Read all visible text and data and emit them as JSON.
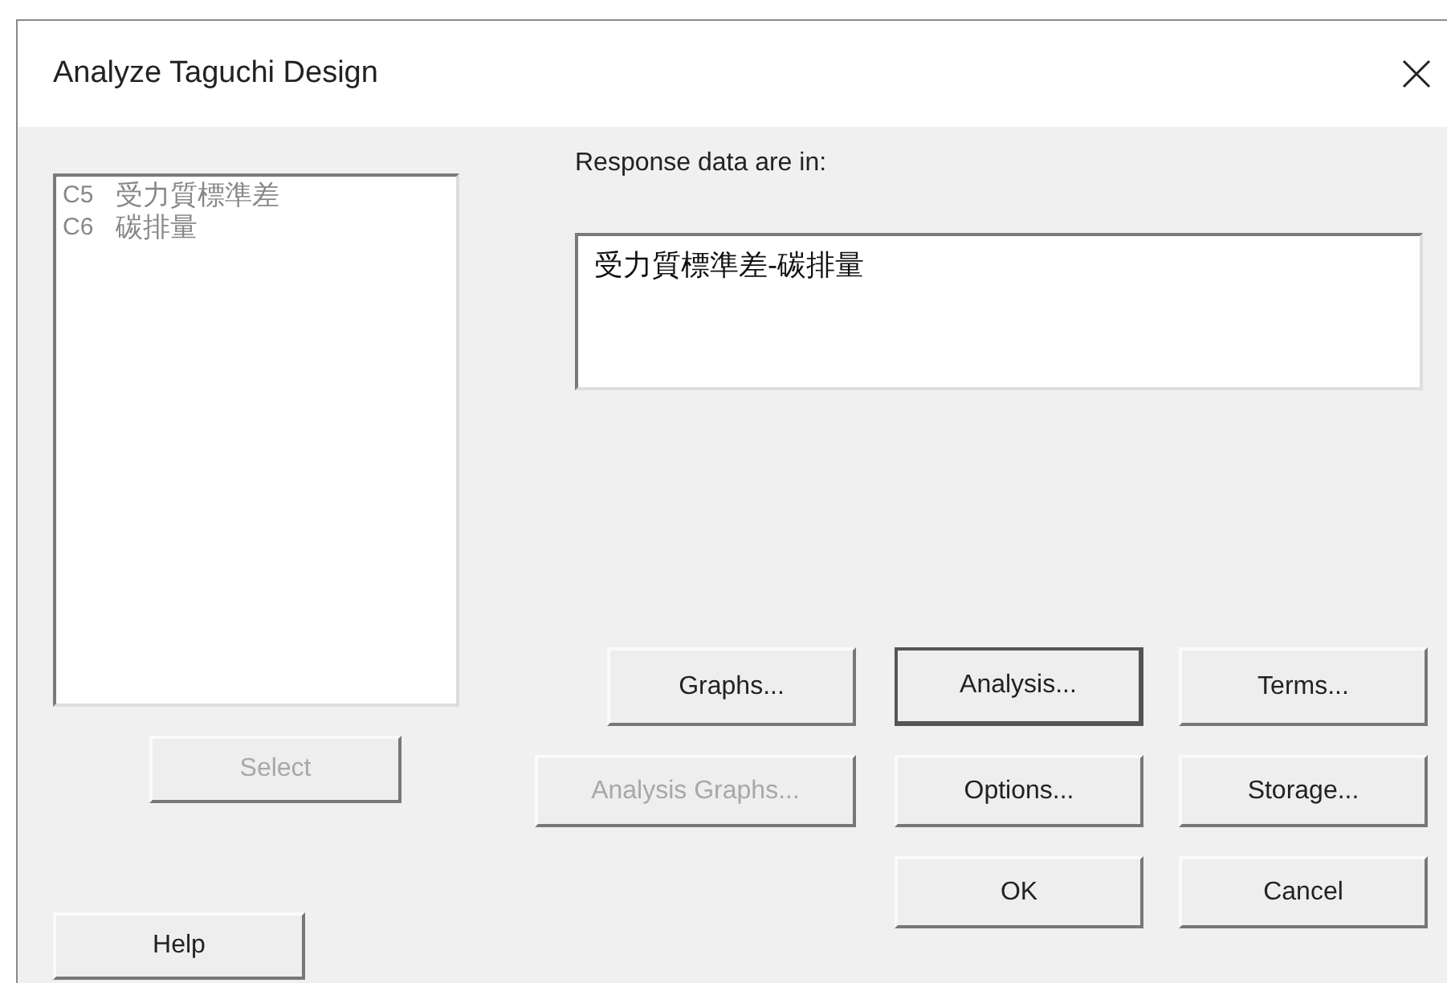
{
  "window": {
    "title": "Analyze Taguchi Design"
  },
  "columns": [
    {
      "id": "C5",
      "name": "受力質標準差"
    },
    {
      "id": "C6",
      "name": "碳排量"
    }
  ],
  "select_button": {
    "label": "Select",
    "disabled": true
  },
  "help_button": {
    "label": "Help"
  },
  "response": {
    "label": "Response data are in:",
    "value": "受力質標準差-碳排量"
  },
  "buttons": [
    {
      "label": "Graphs...",
      "disabled": false,
      "default": false
    },
    {
      "label": "Analysis...",
      "disabled": false,
      "default": true
    },
    {
      "label": "Terms...",
      "disabled": false,
      "default": false
    },
    {
      "label": "Analysis Graphs...",
      "disabled": true,
      "default": false
    },
    {
      "label": "Options...",
      "disabled": false,
      "default": false
    },
    {
      "label": "Storage...",
      "disabled": false,
      "default": false
    },
    {
      "label": "OK",
      "disabled": false,
      "default": false
    },
    {
      "label": "Cancel",
      "disabled": false,
      "default": false
    }
  ]
}
